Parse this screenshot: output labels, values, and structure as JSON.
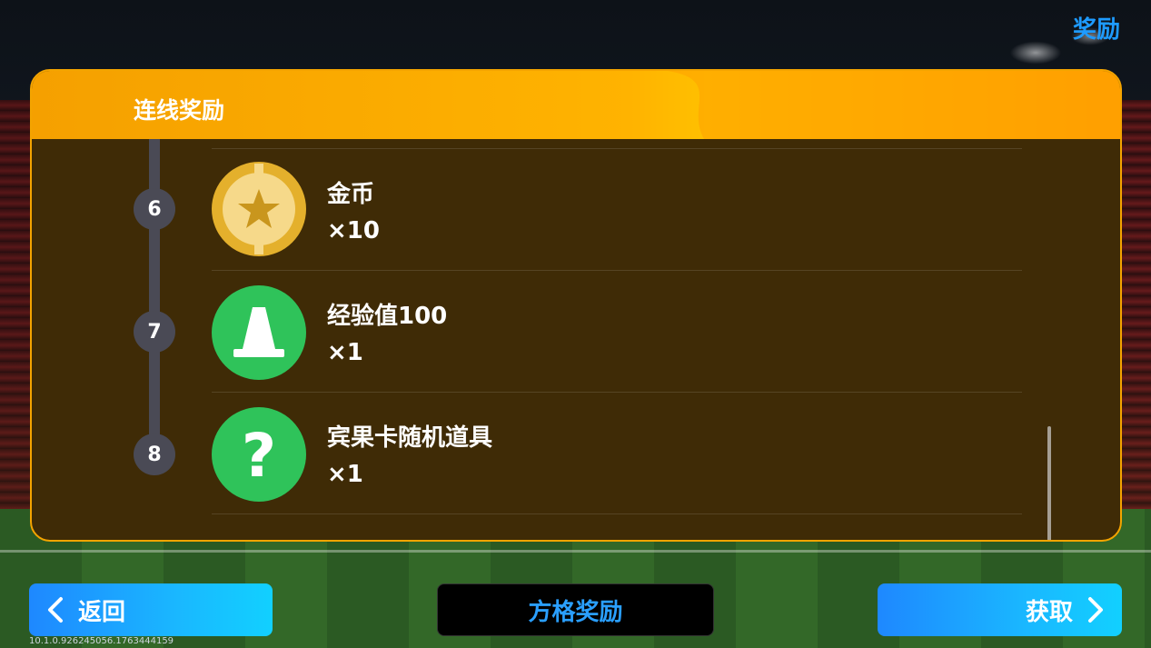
{
  "top_link": "奖励",
  "panel": {
    "title": "连线奖励"
  },
  "rewards": [
    {
      "index": "6",
      "name": "金币",
      "qty": "×10",
      "icon": "gold-star-coin-icon",
      "color": "#e4b02c"
    },
    {
      "index": "7",
      "name": "经验值100",
      "qty": "×1",
      "icon": "training-cone-icon",
      "color": "#2fc35a"
    },
    {
      "index": "8",
      "name": "宾果卡随机道具",
      "qty": "×1",
      "icon": "question-mark-icon",
      "color": "#2fc35a"
    }
  ],
  "buttons": {
    "back": "返回",
    "grid_reward": "方格奖励",
    "get": "获取"
  },
  "version": "10.1.0.926245056.1763444159",
  "colors": {
    "accent_blue": "#1e9bff",
    "panel_bg": "#3f2b06",
    "header_orange": "#ffb300"
  }
}
